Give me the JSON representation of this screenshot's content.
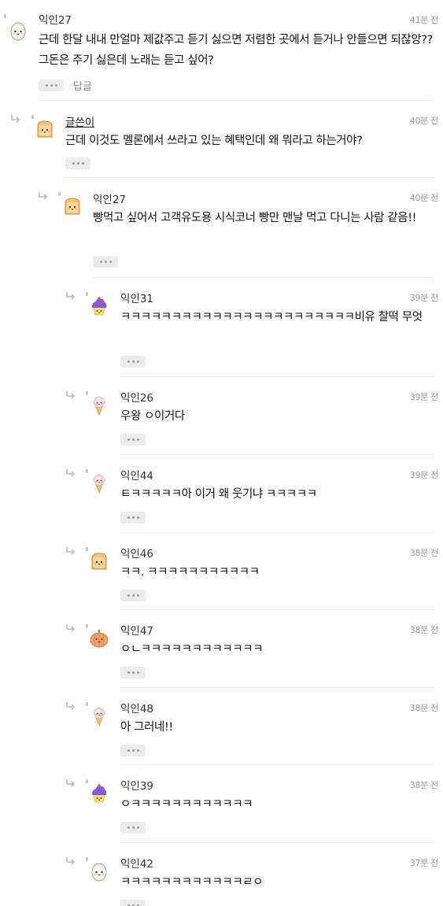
{
  "comments": [
    {
      "author": "익인27",
      "time": "41분 전",
      "text": "근데 한달 내내 만얼마 제값주고 듣기 싫으면 저렴한 곳에서 듣거나 안들으면 되잖앙?? 그돈은 주기 싫은데 노래는 듣고 싶어?",
      "reply": "답글",
      "avatar": "egg-icon"
    },
    {
      "author": "글쓴이",
      "time": "40분 전",
      "text": "근데 이것도 멜론에서 쓰라고 있는 혜택인데 왜 뭐라고 하는거야?",
      "avatar": "toast-icon"
    },
    {
      "author": "익인27",
      "time": "40분 전",
      "text": "빵먹고 싶어서 고객유도용 시식코너 빵만 맨날 먹고 다니는 사람 같음!!",
      "avatar": "toast-icon"
    },
    {
      "author": "익인31",
      "time": "39분 전",
      "text": "ㅋㅋㅋㅋㅋㅋㅋㅋㅋㅋㅋㅋㅋㅋㅋㅋㅋㅋㅋㅋㅋㅋㅋ비유 찰떡 무엇",
      "avatar": "cupcake-icon"
    },
    {
      "author": "익인26",
      "time": "39분 전",
      "text": "우왕 ㅇ이거다",
      "avatar": "icecream-icon"
    },
    {
      "author": "익인44",
      "time": "39분 전",
      "text": "ㅌㅋㅋㅋㅋㅋ아 이거 왜 웃기냐 ㅋㅋㅋㅋㅋ",
      "avatar": "icecream-icon"
    },
    {
      "author": "익인46",
      "time": "38분 전",
      "text": "ㅋㅋ. ㅋㅋㅋㅋㅋㅋㅋㅋㅋㅋㅋ",
      "avatar": "toast-icon"
    },
    {
      "author": "익인47",
      "time": "38분 전",
      "text": "ㅇㄴㅋㅋㅋㅋㅋㅋㅋㅋㅋㅋㅋㅋ",
      "avatar": "pumpkin-icon"
    },
    {
      "author": "익인48",
      "time": "38분 전",
      "text": "아 그러네!!",
      "avatar": "icecream-icon"
    },
    {
      "author": "익인39",
      "time": "38분 전",
      "text": "ㅇㅋㅋㅋㅋㅋㅋㅋㅋㅋㅋㅋㅋ",
      "avatar": "cupcake-icon"
    },
    {
      "author": "익인42",
      "time": "37분 전",
      "text": "ㅋㅋㅋㅋㅋㅋㅋㅋㅋㅋㅋㅋㄹㅇ",
      "avatar": "egg-icon"
    }
  ],
  "colors": {
    "background": "#ffffff",
    "meta": "#9a9a9a",
    "more_button": "#ececec"
  }
}
